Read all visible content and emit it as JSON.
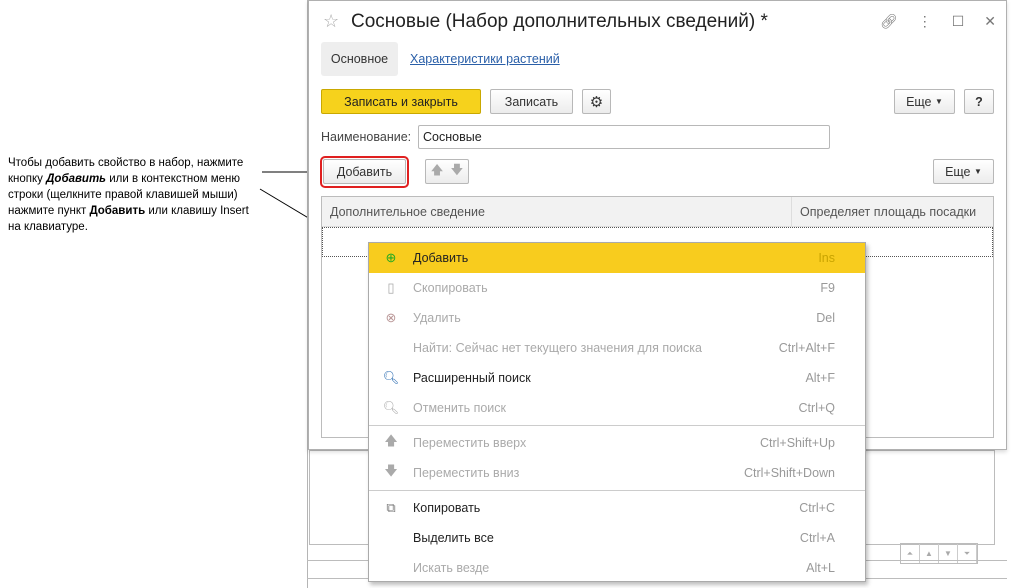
{
  "annotation": {
    "lines": [
      "Чтобы добавить свойство в набор, нажмите",
      "кнопку ",
      "Добавить",
      " или в контекстном меню",
      "строки (щелкните правой клавишей мыши)",
      "нажмите пункт ",
      "Добавить",
      " или клавишу Insert",
      "на клавиатуре."
    ]
  },
  "window": {
    "title": "Сосновые (Набор дополнительных сведений) *",
    "tabs": [
      "Основное",
      "Характеристики растений"
    ]
  },
  "toolbar": {
    "save_close": "Записать и закрыть",
    "save": "Записать",
    "more": "Еще",
    "help": "?"
  },
  "form": {
    "name_label": "Наименование:",
    "name_value": "Сосновые"
  },
  "table_toolbar": {
    "add": "Добавить",
    "more": "Еще"
  },
  "table": {
    "columns": [
      "Дополнительное сведение",
      "Определяет площадь посадки"
    ]
  },
  "menu": {
    "items": [
      {
        "label": "Добавить",
        "shortcut": "Ins",
        "icon": "add-icon"
      },
      {
        "label": "Скопировать",
        "shortcut": "F9",
        "icon": "copy-row-icon"
      },
      {
        "label": "Удалить",
        "shortcut": "Del",
        "icon": "delete-icon"
      },
      {
        "label": "Найти: Сейчас нет текущего значения для поиска",
        "shortcut": "Ctrl+Alt+F"
      },
      {
        "label": "Расширенный поиск",
        "shortcut": "Alt+F",
        "icon": "search-icon"
      },
      {
        "label": "Отменить поиск",
        "shortcut": "Ctrl+Q",
        "icon": "cancel-search-icon"
      },
      {
        "label": "Переместить вверх",
        "shortcut": "Ctrl+Shift+Up",
        "icon": "arrow-up-icon"
      },
      {
        "label": "Переместить вниз",
        "shortcut": "Ctrl+Shift+Down",
        "icon": "arrow-down-icon"
      },
      {
        "label": "Копировать",
        "shortcut": "Ctrl+C",
        "icon": "copy-icon"
      },
      {
        "label": "Выделить все",
        "shortcut": "Ctrl+A"
      },
      {
        "label": "Искать везде",
        "shortcut": "Alt+L"
      }
    ]
  }
}
